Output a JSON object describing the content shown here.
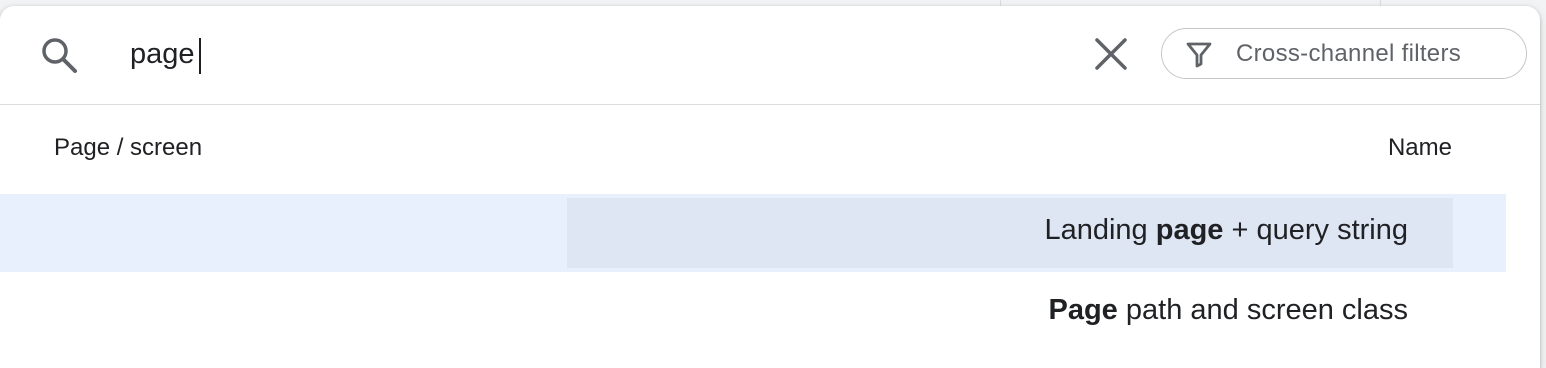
{
  "search": {
    "value": "page",
    "icon": "search-icon",
    "clear_icon": "close-icon"
  },
  "filter": {
    "label": "Cross-channel filters",
    "icon": "filter-icon"
  },
  "columns": {
    "left": "Page / screen",
    "right": "Name"
  },
  "results": [
    {
      "before": "Landing ",
      "match": "page",
      "after": " + query string",
      "selected": true
    },
    {
      "before": "",
      "match": "Page",
      "after": " path and screen class",
      "selected": false
    }
  ],
  "colors": {
    "selected_row": "#e8f0fe",
    "highlight": "#dfe6f3",
    "accent": "#1a73e8"
  }
}
